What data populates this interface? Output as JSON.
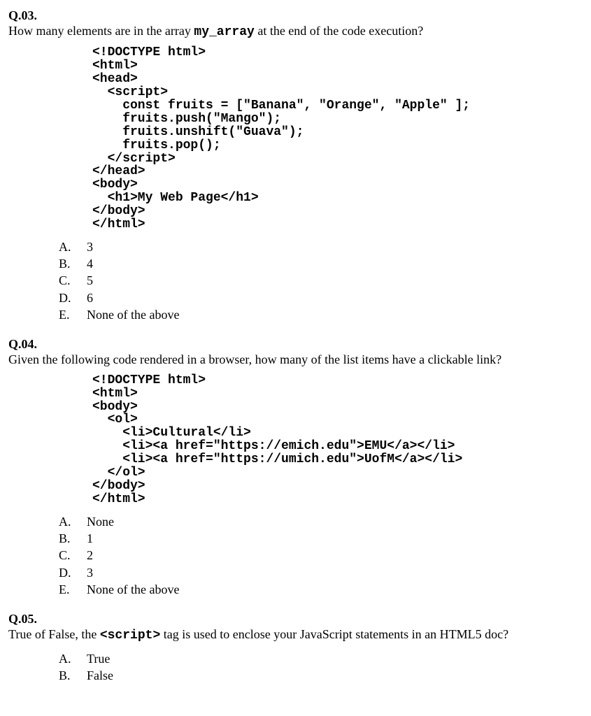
{
  "q03": {
    "header": "Q.03.",
    "prompt_pre": "How many elements are in the array ",
    "prompt_code": "my_array",
    "prompt_post": " at the end of the code execution?",
    "code": "<!DOCTYPE html>\n<html>\n<head>\n  <script>\n    const fruits = [\"Banana\", \"Orange\", \"Apple\" ];\n    fruits.push(\"Mango\");\n    fruits.unshift(\"Guava\");\n    fruits.pop();\n  </script>\n</head>\n<body>\n  <h1>My Web Page</h1>\n</body>\n</html>",
    "options": [
      {
        "letter": "A.",
        "text": "3"
      },
      {
        "letter": "B.",
        "text": "4"
      },
      {
        "letter": "C.",
        "text": "5"
      },
      {
        "letter": "D.",
        "text": "6"
      },
      {
        "letter": "E.",
        "text": "None of the above"
      }
    ]
  },
  "q04": {
    "header": "Q.04.",
    "prompt": "Given the following code rendered in a browser, how many of the list items have a clickable link?",
    "code": "<!DOCTYPE html>\n<html>\n<body>\n  <ol>\n    <li>Cultural</li>\n    <li><a href=\"https://emich.edu\">EMU</a></li>\n    <li><a href=\"https://umich.edu\">UofM</a></li>\n  </ol>\n</body>\n</html>",
    "options": [
      {
        "letter": "A.",
        "text": "None"
      },
      {
        "letter": "B.",
        "text": "1"
      },
      {
        "letter": "C.",
        "text": "2"
      },
      {
        "letter": "D.",
        "text": "3"
      },
      {
        "letter": "E.",
        "text": "None of the above"
      }
    ]
  },
  "q05": {
    "header": "Q.05.",
    "prompt_pre": "True of False, the ",
    "prompt_code": "<script>",
    "prompt_post": " tag is used to enclose your JavaScript statements in an HTML5 doc?",
    "options": [
      {
        "letter": "A.",
        "text": "True"
      },
      {
        "letter": "B.",
        "text": "False"
      }
    ]
  }
}
